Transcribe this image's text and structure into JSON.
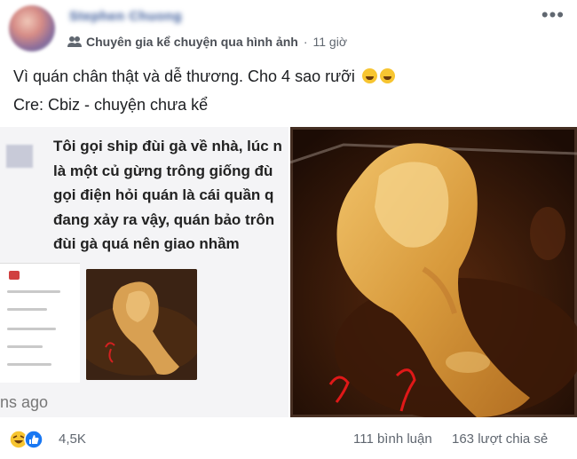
{
  "author": {
    "name": "Stephen Chuong"
  },
  "meta": {
    "group": "Chuyên gia kể chuyện qua hình ảnh",
    "separator": "·",
    "time": "11 giờ"
  },
  "post": {
    "line1": "Vì quán chân thật và dễ thương. Cho 4 sao rưỡi",
    "line2": "Cre: Cbiz - chuyện chưa kể"
  },
  "media": {
    "comment_lines": [
      "Tôi gọi ship đùi gà về nhà, lúc n",
      "là một củ gừng trông giống đù",
      "gọi điện hỏi quán là cái quần q",
      "đang xảy ra vậy, quán bảo trôn",
      "đùi gà quá nên giao nhầm"
    ],
    "ago": "ns ago"
  },
  "footer": {
    "reactions": "4,5K",
    "comments": "111 bình luận",
    "shares": "163 lượt chia sẻ"
  },
  "colors": {
    "link": "#385898",
    "meta": "#606770",
    "like": "#1877f2",
    "haha": "#f7c531"
  }
}
